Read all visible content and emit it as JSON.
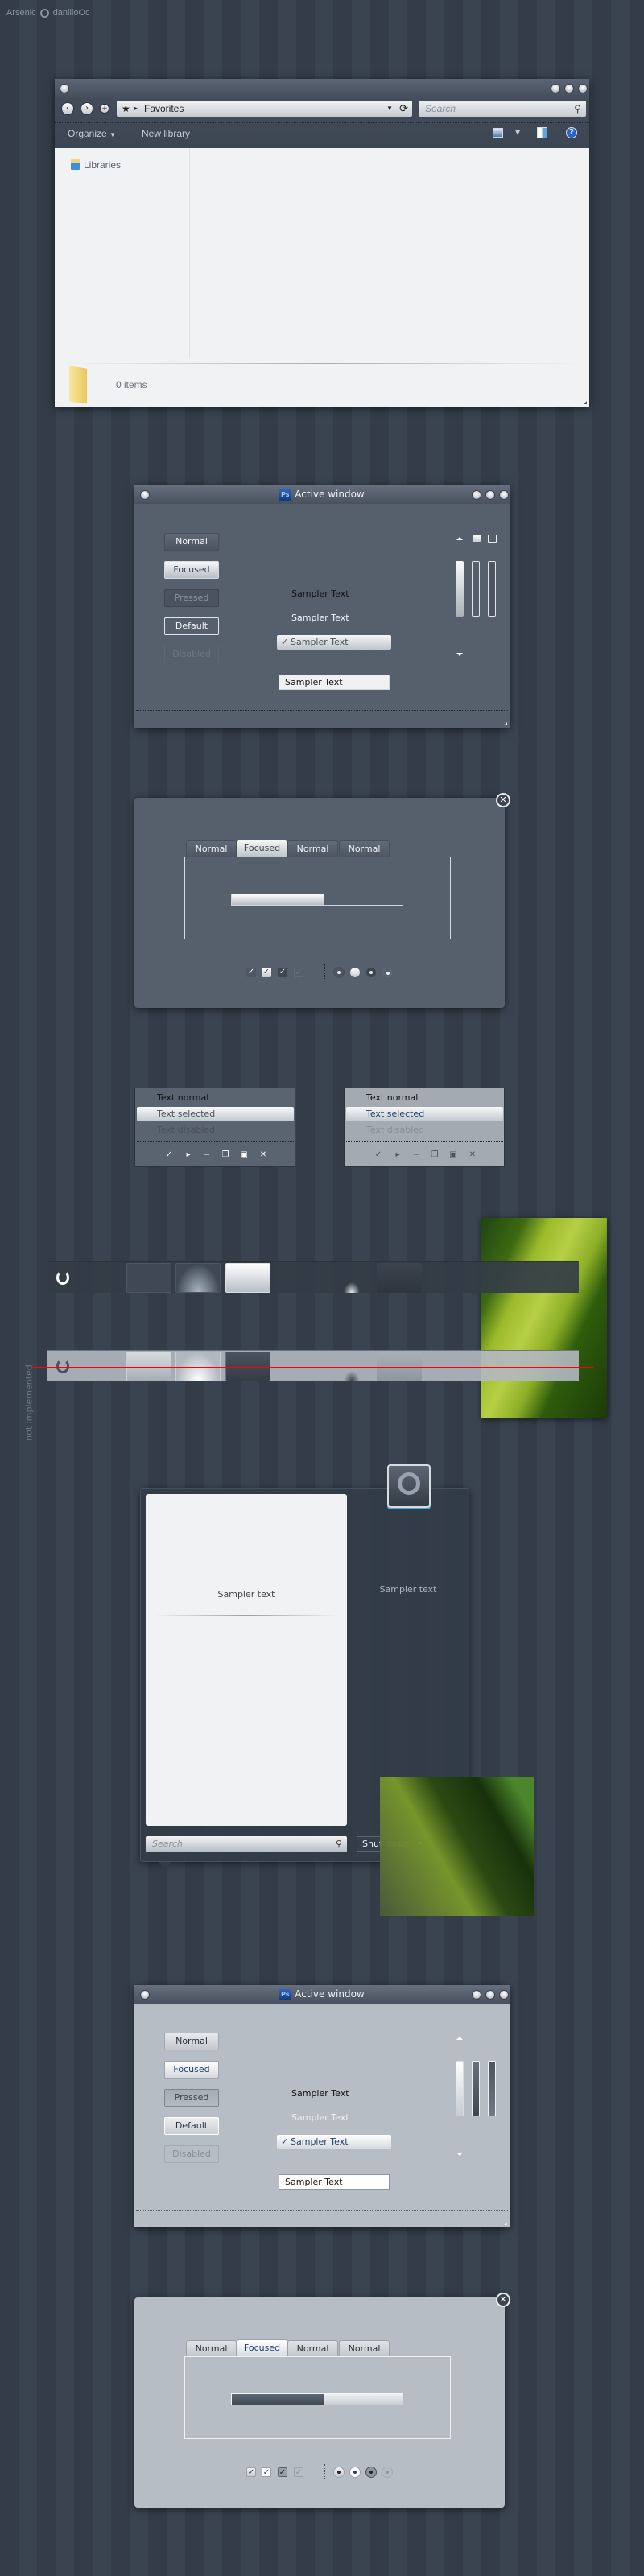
{
  "header": {
    "theme": "Arsenic",
    "author": "danilloOc",
    "author_icon": "user-avatar-icon"
  },
  "explorer": {
    "address": "Favorites",
    "search_placeholder": "Search",
    "toolbar": {
      "organize": "Organize",
      "new_library": "New library"
    },
    "nav": {
      "libraries": "Libraries"
    },
    "status": "0 items"
  },
  "dark_window": {
    "title": "Active window",
    "app_icon": "Ps",
    "buttons": [
      "Normal",
      "Focused",
      "Pressed",
      "Default",
      "Disabled"
    ],
    "labels": [
      "Sampler Text",
      "Sampler Text"
    ],
    "combo": "Sampler Text",
    "combo_check": "✓",
    "input": "Sampler Text"
  },
  "dark_dialog": {
    "tabs": [
      "Normal",
      "Focused",
      "Normal",
      "Normal"
    ],
    "progress_percent": 54,
    "close_glyph": "✕"
  },
  "menu": {
    "normal": "Text normal",
    "selected": "Text selected",
    "disabled": "Text disabled",
    "icons": [
      "✓",
      "▸",
      "−",
      "❐",
      "▣",
      "✕"
    ]
  },
  "taskbar": {
    "not_implemented": "not implemented",
    "red_line_color": "#ff0000"
  },
  "start_menu": {
    "left_text": "Sampler text",
    "right_text": "Sampler text",
    "search_placeholder": "Search",
    "shutdown": "Shut down",
    "shutdown_arrow": "▸"
  },
  "light_window": {
    "title": "Active window",
    "app_icon": "Ps",
    "buttons": [
      "Normal",
      "Focused",
      "Pressed",
      "Default",
      "Disabled"
    ],
    "labels": [
      "Sampler Text",
      "Sampler Text"
    ],
    "combo": "Sampler Text",
    "combo_check": "✓",
    "input": "Sampler Text"
  },
  "light_dialog": {
    "tabs": [
      "Normal",
      "Focused",
      "Normal",
      "Normal"
    ],
    "progress_percent": 54,
    "close_glyph": "✕"
  },
  "colors": {
    "background": "#353f4b",
    "dark_surface": "#56606c",
    "light_surface": "#b6bdc4",
    "accent_text": "#233f6e"
  }
}
